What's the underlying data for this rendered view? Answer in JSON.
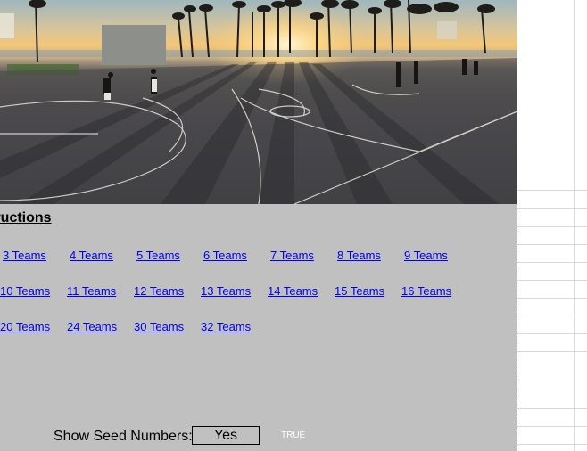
{
  "photo": {
    "description": "basketball-court-at-sunset-banner"
  },
  "panel": {
    "heading": "Instructions",
    "heading_visible": "uctions",
    "rows": [
      [
        {
          "label": "3 Teams"
        },
        {
          "label": "4 Teams"
        },
        {
          "label": "5 Teams"
        },
        {
          "label": "6 Teams"
        },
        {
          "label": "7 Teams"
        },
        {
          "label": "8 Teams"
        },
        {
          "label": "9 Teams"
        }
      ],
      [
        {
          "label": "10 Teams"
        },
        {
          "label": "11 Teams"
        },
        {
          "label": "12 Teams"
        },
        {
          "label": "13 Teams"
        },
        {
          "label": "14 Teams"
        },
        {
          "label": "15 Teams"
        },
        {
          "label": "16 Teams"
        }
      ],
      [
        {
          "label": "20 Teams"
        },
        {
          "label": "24 Teams"
        },
        {
          "label": "30 Teams"
        },
        {
          "label": "32 Teams"
        }
      ]
    ],
    "seed": {
      "label": "Show Seed Numbers:",
      "value": "Yes",
      "flag": "TRUE"
    }
  },
  "colors": {
    "panel_bg": "#c0c0c0",
    "link": "#0000ee",
    "grid_line": "#d9d9d9"
  }
}
